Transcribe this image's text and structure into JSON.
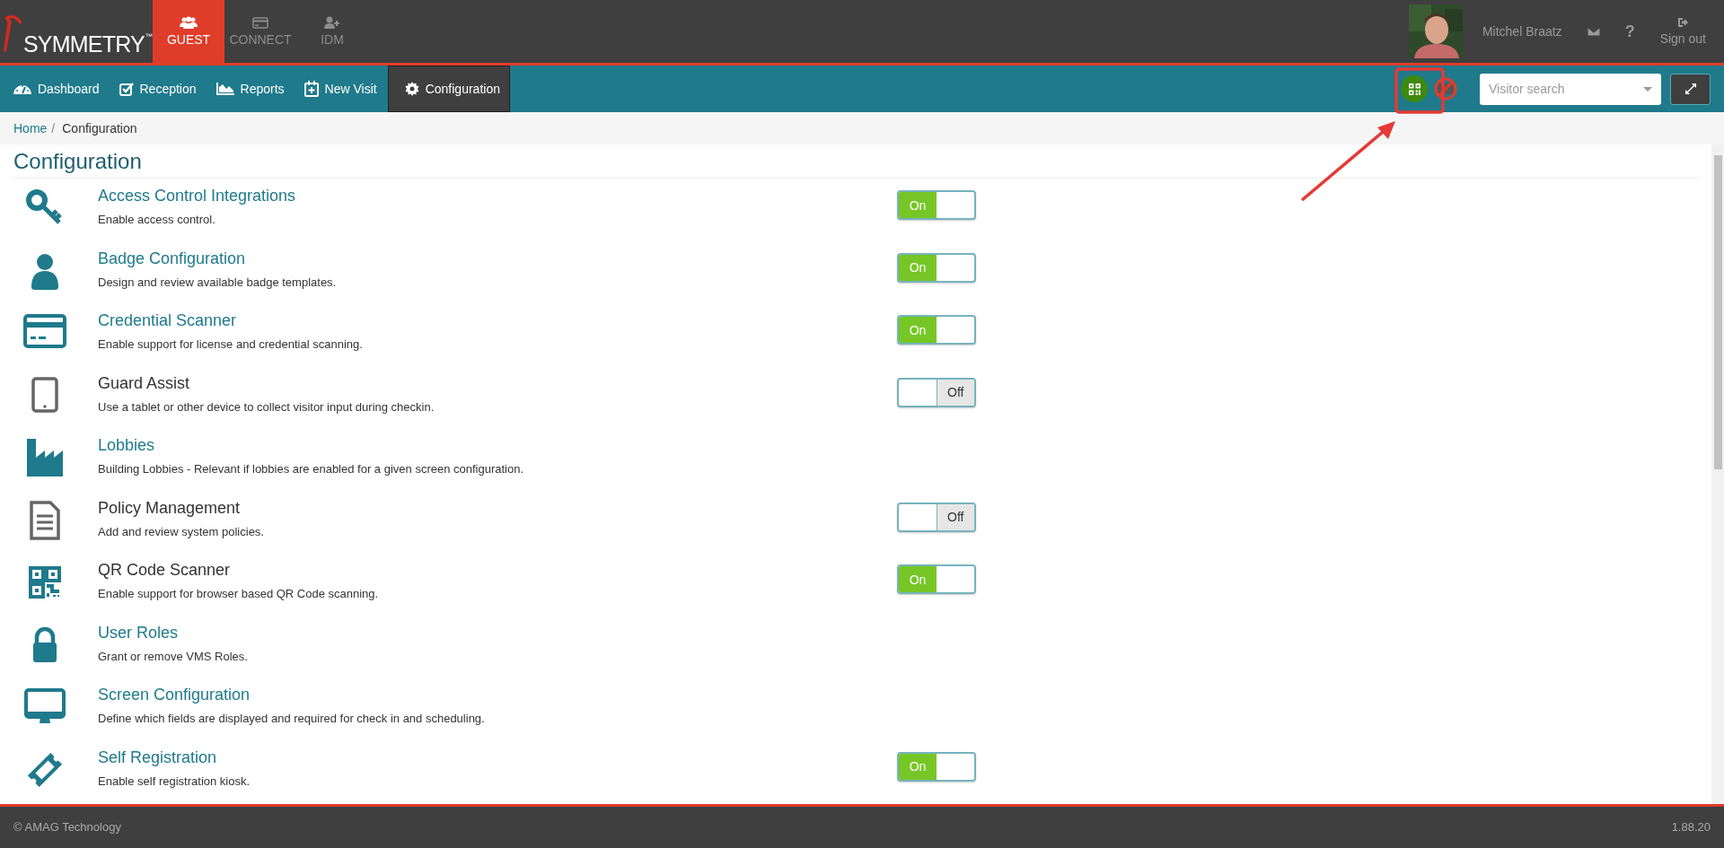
{
  "header": {
    "logo": "SYMMETRY",
    "logo_mark": "™",
    "apps": [
      {
        "label": "GUEST",
        "selected": true
      },
      {
        "label": "CONNECT",
        "selected": false
      },
      {
        "label": "IDM",
        "selected": false
      }
    ],
    "user": {
      "name": "Mitchel Braatz"
    },
    "help": "?",
    "sign_out": "Sign out"
  },
  "nav": {
    "tabs": [
      {
        "label": "Dashboard",
        "selected": false
      },
      {
        "label": "Reception",
        "selected": false
      },
      {
        "label": "Reports",
        "selected": false
      },
      {
        "label": "New Visit",
        "selected": false
      },
      {
        "label": "Configuration",
        "selected": true
      }
    ],
    "qr_scanner_on": true,
    "credential_scanner_blocked": true,
    "search": {
      "placeholder": "Visitor search"
    }
  },
  "breadcrumb": [
    {
      "label": "Home",
      "link": true
    },
    {
      "separator": "/"
    },
    {
      "label": "Configuration",
      "link": false
    }
  ],
  "page_title": "Configuration",
  "items": [
    {
      "title": "Access Control Integrations",
      "description": "Enable access control.",
      "linked": true,
      "toggle": {
        "on": true,
        "label": "On"
      }
    },
    {
      "title": "Badge Configuration",
      "description": "Design and review available badge templates.",
      "linked": true,
      "toggle": {
        "on": true,
        "label": "On"
      }
    },
    {
      "title": "Credential Scanner",
      "description": "Enable support for license and credential scanning.",
      "linked": true,
      "toggle": {
        "on": true,
        "label": "On"
      }
    },
    {
      "title": "Guard Assist",
      "description": "Use a tablet or other device to collect visitor input during checkin.",
      "linked": false,
      "toggle": {
        "on": false,
        "label": "Off"
      }
    },
    {
      "title": "Lobbies",
      "description": "Building Lobbies - Relevant if lobbies are enabled for a given screen configuration.",
      "linked": true
    },
    {
      "title": "Policy Management",
      "description": "Add and review system policies.",
      "linked": false,
      "toggle": {
        "on": false,
        "label": "Off"
      }
    },
    {
      "title": "QR Code Scanner",
      "description": "Enable support for browser based QR Code scanning.",
      "linked": false,
      "toggle": {
        "on": true,
        "label": "On"
      }
    },
    {
      "title": "User Roles",
      "description": "Grant or remove VMS Roles.",
      "linked": true
    },
    {
      "title": "Screen Configuration",
      "description": "Define which fields are displayed and required for check in and scheduling.",
      "linked": true
    },
    {
      "title": "Self Registration",
      "description": "Enable self registration kiosk.",
      "linked": true,
      "toggle": {
        "on": true,
        "label": "On"
      }
    }
  ],
  "footer": {
    "copyright": "© AMAG Technology",
    "version": "1.88.20"
  }
}
